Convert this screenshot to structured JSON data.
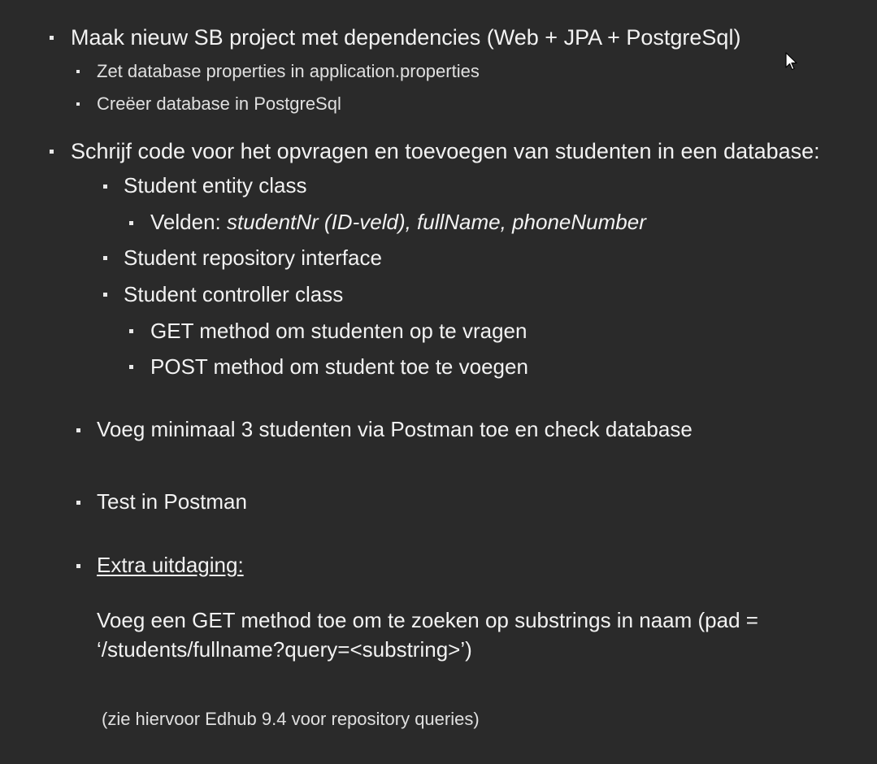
{
  "slide": {
    "item1": {
      "text": "Maak nieuw SB project  met dependencies (Web +  JPA + PostgreSql)",
      "sub": [
        "Zet database properties in application.properties",
        "Creëer database in PostgreSql"
      ]
    },
    "item2": {
      "text": "Schrijf code voor het opvragen en toevoegen van studenten in een database:",
      "entity": "Student entity class",
      "fields_label": "Velden: ",
      "fields_value": "studentNr (ID-veld), fullName, phoneNumber",
      "repository": "Student repository interface",
      "controller": "Student controller class",
      "get": "GET method om studenten op te vragen",
      "post": "POST method om student toe te voegen"
    },
    "item3": "Voeg minimaal 3 studenten via Postman toe en check database",
    "item4": "Test in Postman",
    "item5": {
      "heading": "Extra uitdaging:",
      "line1": "Voeg een GET method toe om te zoeken op substrings in naam (pad =",
      "line2": "‘/students/fullname?query=<substring>’)",
      "note": "(zie hiervoor Edhub 9.4 voor repository queries)"
    }
  }
}
